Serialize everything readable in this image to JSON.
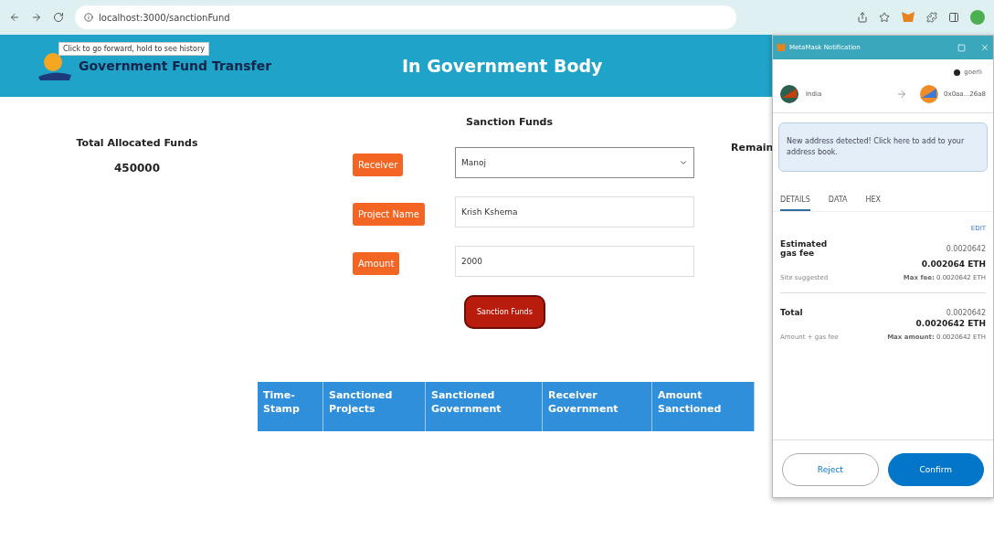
{
  "browser": {
    "url": "localhost:3000/sanctionFund",
    "tooltip": "Click to go forward, hold to see history"
  },
  "header": {
    "brand": "Government Fund Transfer",
    "title": "In Government Body"
  },
  "allocated": {
    "label": "Total Allocated Funds",
    "value": "450000"
  },
  "form": {
    "title": "Sanction Funds",
    "fields": [
      {
        "kind": "select",
        "label": "Receiver",
        "value": "Manoj"
      },
      {
        "kind": "text",
        "label": "Project Name",
        "value": "Krish Kshema"
      },
      {
        "kind": "text",
        "label": "Amount",
        "value": "2000"
      }
    ],
    "submit": "Sanction Funds"
  },
  "remaining": {
    "label": "Remain"
  },
  "table": {
    "columns": [
      "Time-Stamp",
      "Sanctioned Projects",
      "Sanctioned Government",
      "Receiver Government",
      "Amount Sanctioned"
    ]
  },
  "popup": {
    "title": "MetaMask Notification",
    "network": "goerli",
    "from": "India",
    "to": "0x0aa...26a8",
    "notice": "New address detected! Click here to add to your address book.",
    "tabs": [
      {
        "label": "DETAILS",
        "selected": true
      },
      {
        "label": "DATA",
        "selected": false
      },
      {
        "label": "HEX",
        "selected": false
      }
    ],
    "edit": "EDIT",
    "gas": {
      "label": "Estimated gas fee",
      "small": "0.0020642",
      "value": "0.002064 ETH",
      "note": "Site suggested",
      "max_label": "Max fee:",
      "max": "0.0020642 ETH"
    },
    "total": {
      "label": "Total",
      "small": "0.0020642",
      "value": "0.0020642 ETH",
      "note": "Amount + gas fee",
      "max_label": "Max amount:",
      "max": "0.0020642 ETH"
    },
    "buttons": [
      {
        "kind": "secondary",
        "label": "Reject"
      },
      {
        "kind": "primary",
        "label": "Confirm"
      }
    ]
  }
}
